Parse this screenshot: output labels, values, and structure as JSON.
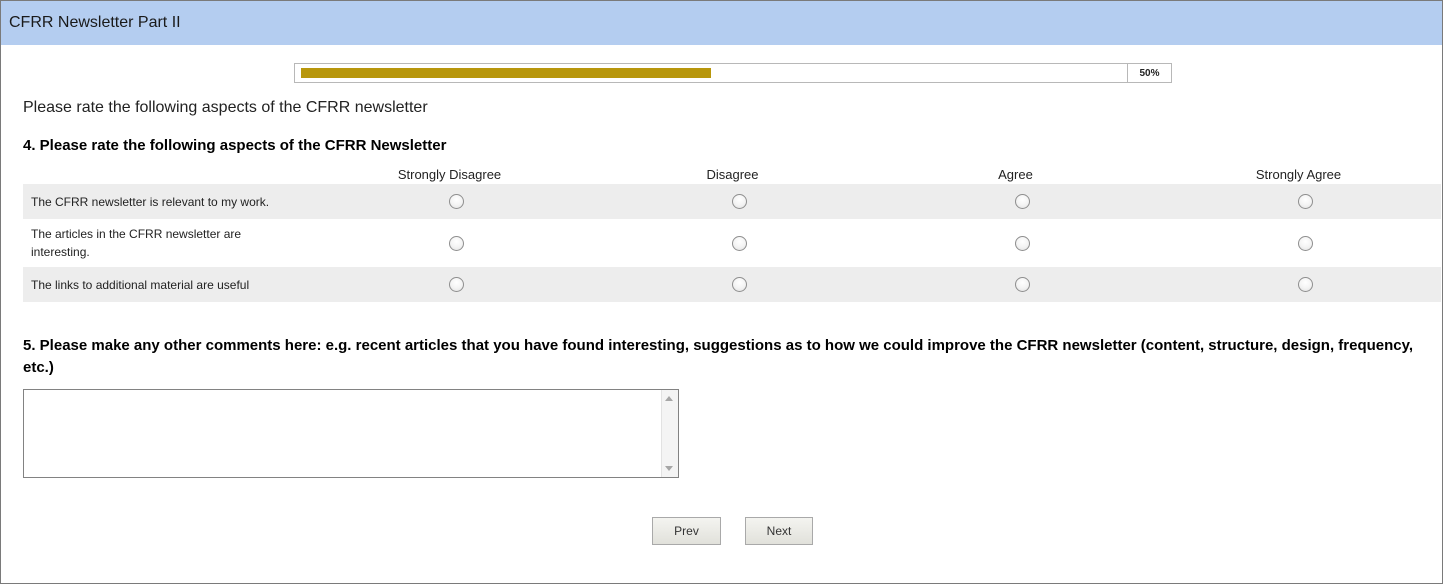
{
  "page": {
    "title": "CFRR Newsletter Part II"
  },
  "progress": {
    "percent_label": "50%",
    "fraction": 0.5
  },
  "intro_text": "Please rate the following aspects of the CFRR newsletter",
  "question4": {
    "title": "4. Please rate the following aspects of the CFRR Newsletter",
    "columns": [
      "Strongly Disagree",
      "Disagree",
      "Agree",
      "Strongly Agree"
    ],
    "rows": [
      {
        "label": "The CFRR newsletter is relevant to my work."
      },
      {
        "label": "The articles in the CFRR newsletter are interesting."
      },
      {
        "label": "The links to additional material are useful"
      }
    ]
  },
  "question5": {
    "title": "5. Please make any other comments here: e.g. recent articles that you have found interesting, suggestions as to how we could improve the CFRR newsletter (content, structure, design, frequency, etc.)",
    "value": ""
  },
  "buttons": {
    "prev": "Prev",
    "next": "Next"
  },
  "colors": {
    "title_bar": "#b4cdf0",
    "progress_fill": "#b8970c",
    "row_shade": "#ededed"
  }
}
